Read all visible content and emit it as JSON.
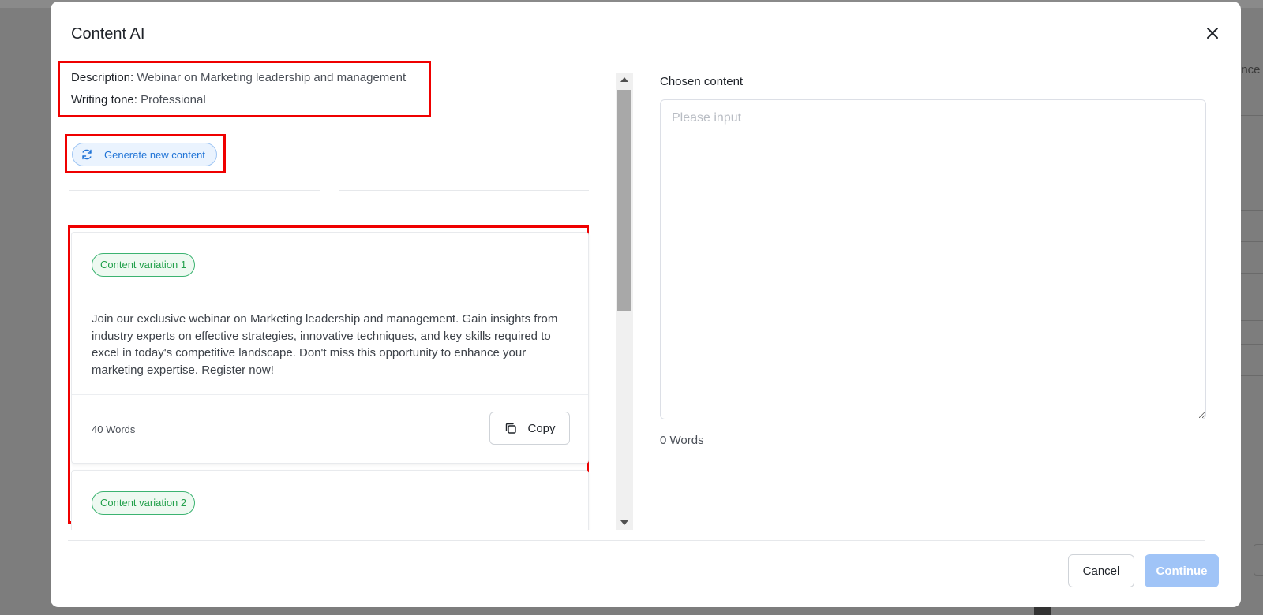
{
  "background": {
    "right_fragment_text": "ance"
  },
  "modal": {
    "title": "Content AI",
    "info": {
      "description_label": "Description:",
      "description_value": "Webinar on Marketing leadership and management",
      "tone_label": "Writing tone:",
      "tone_value": "Professional"
    },
    "generate_button_label": "Generate new content",
    "variations": [
      {
        "badge": "Content variation 1",
        "text": "Join our exclusive webinar on Marketing leadership and management. Gain insights from industry experts on effective strategies, innovative techniques, and key skills required to excel in today's competitive landscape. Don't miss this opportunity to enhance your marketing expertise. Register now!",
        "word_count": "40 Words",
        "copy_label": "Copy"
      },
      {
        "badge": "Content variation 2"
      }
    ],
    "chosen": {
      "label": "Chosen content",
      "placeholder": "Please input",
      "value": "",
      "word_count": "0 Words"
    },
    "footer": {
      "cancel_label": "Cancel",
      "continue_label": "Continue"
    }
  },
  "colors": {
    "annotation": "#ef0000",
    "primary": "#1f73d6",
    "success": "#22a04b",
    "continue_disabled": "#a0c4f7"
  }
}
